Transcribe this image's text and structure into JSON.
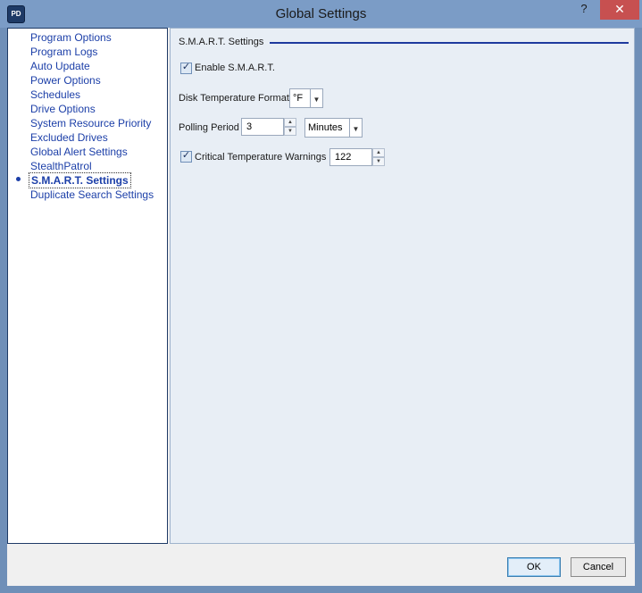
{
  "window": {
    "title": "Global Settings",
    "app_icon_text": "PD",
    "help_label": "?",
    "close_label": "✕"
  },
  "nav": {
    "items": [
      {
        "label": "Program Options"
      },
      {
        "label": "Program Logs"
      },
      {
        "label": "Auto Update"
      },
      {
        "label": "Power Options"
      },
      {
        "label": "Schedules"
      },
      {
        "label": "Drive Options"
      },
      {
        "label": "System Resource Priority"
      },
      {
        "label": "Excluded Drives"
      },
      {
        "label": "Global Alert Settings"
      },
      {
        "label": "StealthPatrol"
      },
      {
        "label": "S.M.A.R.T. Settings",
        "selected": true
      },
      {
        "label": "Duplicate Search Settings"
      }
    ]
  },
  "smart": {
    "section_title": "S.M.A.R.T. Settings",
    "enable_label": "Enable S.M.A.R.T.",
    "enable_checked": true,
    "disk_temp_format_label": "Disk Temperature Format",
    "disk_temp_format_value": "°F",
    "polling_period_label": "Polling Period",
    "polling_period_value": "3",
    "polling_unit_value": "Minutes",
    "critical_temp_label": "Critical Temperature Warnings",
    "critical_temp_checked": true,
    "critical_temp_value": "122"
  },
  "footer": {
    "ok_label": "OK",
    "cancel_label": "Cancel"
  },
  "colors": {
    "frame": "#7b9cc6",
    "close_button": "#c75050",
    "link": "#1c3fa8",
    "section_rule": "#1e3a9e"
  }
}
